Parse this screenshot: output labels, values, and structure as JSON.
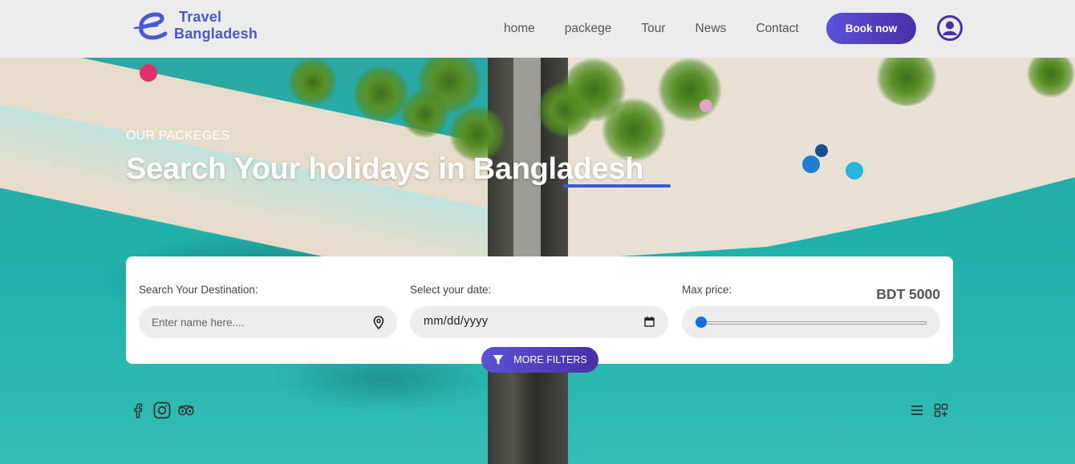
{
  "header": {
    "brand_line1": "Travel",
    "brand_line2": "Bangladesh",
    "nav": [
      {
        "label": "home"
      },
      {
        "label": "packege"
      },
      {
        "label": "Tour"
      },
      {
        "label": "News"
      },
      {
        "label": "Contact"
      }
    ],
    "book_label": "Book now",
    "accent_color": "#4a57d6",
    "button_gradient": [
      "#5a52d8",
      "#4b2ea8"
    ]
  },
  "hero": {
    "eyebrow": "OUR PACKEGES",
    "headline": "Search Your holidays in Bangladesh"
  },
  "search": {
    "destination_label": "Search Your Destination:",
    "destination_placeholder": "Enter name here....",
    "date_label": "Select your date:",
    "date_value": "mm/dd/yyyy",
    "price_label": "Max price:",
    "price_value": "BDT 5000",
    "price_slider_fraction": 0,
    "more_filters_label": "MORE FILTERS"
  },
  "footer_icons": {
    "social": [
      "facebook-icon",
      "instagram-icon",
      "tripadvisor-icon"
    ],
    "view_toggles": [
      "list-view-icon",
      "grid-view-icon"
    ]
  }
}
